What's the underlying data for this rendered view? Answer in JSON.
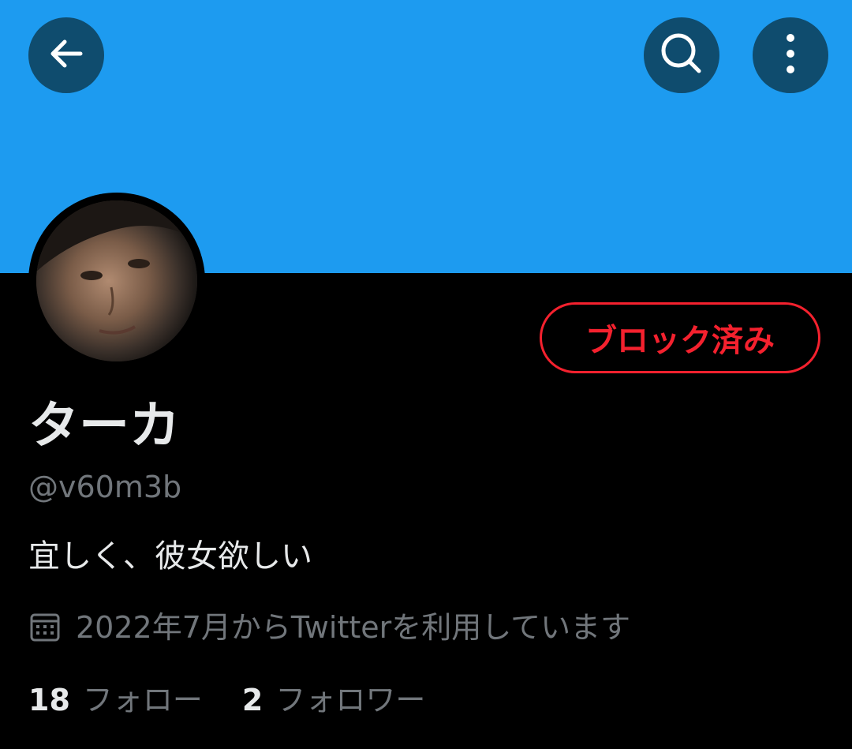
{
  "colors": {
    "banner": "#1d9bf0",
    "button_bg": "#0f4c6e",
    "blocked": "#f4212e",
    "text_primary": "#e7e9ea",
    "text_secondary": "#71767b",
    "background": "#000000"
  },
  "header": {
    "back_icon": "arrow-left-icon",
    "search_icon": "search-icon",
    "more_icon": "more-vertical-icon"
  },
  "profile": {
    "blocked_label": "ブロック済み",
    "display_name": "ターカ",
    "handle": "@v60m3b",
    "bio": "宜しく、彼女欲しい",
    "joined_icon": "calendar-icon",
    "joined": "2022年7月からTwitterを利用しています",
    "following_count": "18",
    "following_label": "フォロー",
    "followers_count": "2",
    "followers_label": "フォロワー"
  }
}
